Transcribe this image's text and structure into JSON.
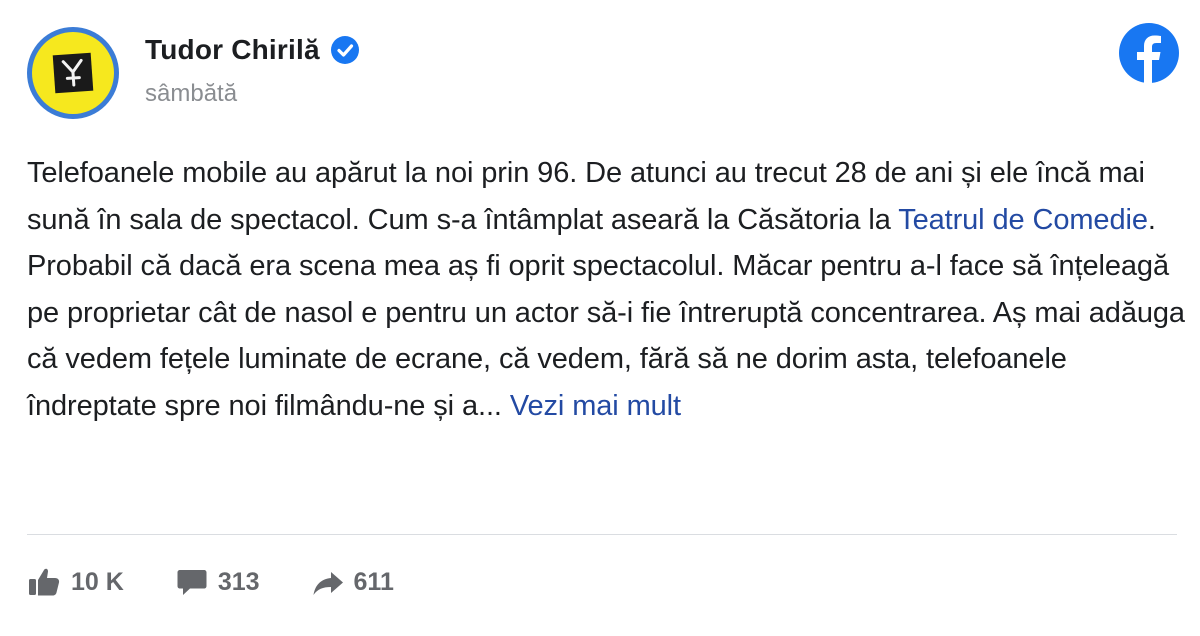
{
  "header": {
    "author_name": "Tudor Chirilă",
    "timestamp": "sâmbătă",
    "verified_icon": "verified-badge-icon",
    "platform_icon": "facebook-logo-icon"
  },
  "post": {
    "text_before_link": "Telefoanele mobile au apărut la noi prin 96. De atunci au trecut 28 de ani și ele încă mai sună în sala de spectacol. Cum s-a întâmplat aseară la Căsătoria la ",
    "link_text": "Teatrul de Comedie",
    "text_after_link": ". Probabil că dacă era scena mea aș fi oprit spectacolul. Măcar pentru a-l face să înțeleagă pe proprietar cât de nasol e pentru un actor să-i fie întreruptă concentrarea. Aș mai adăuga că vedem fețele luminate de ecrane, că vedem, fără să ne dorim asta, telefoanele îndreptate spre noi filmându-ne și a... ",
    "see_more": "Vezi mai mult"
  },
  "stats": {
    "likes": "10 K",
    "comments": "313",
    "shares": "611"
  },
  "colors": {
    "brand_blue": "#1877f2",
    "link_blue": "#234aa3",
    "muted_gray": "#65676b",
    "avatar_yellow": "#f6e81e"
  }
}
